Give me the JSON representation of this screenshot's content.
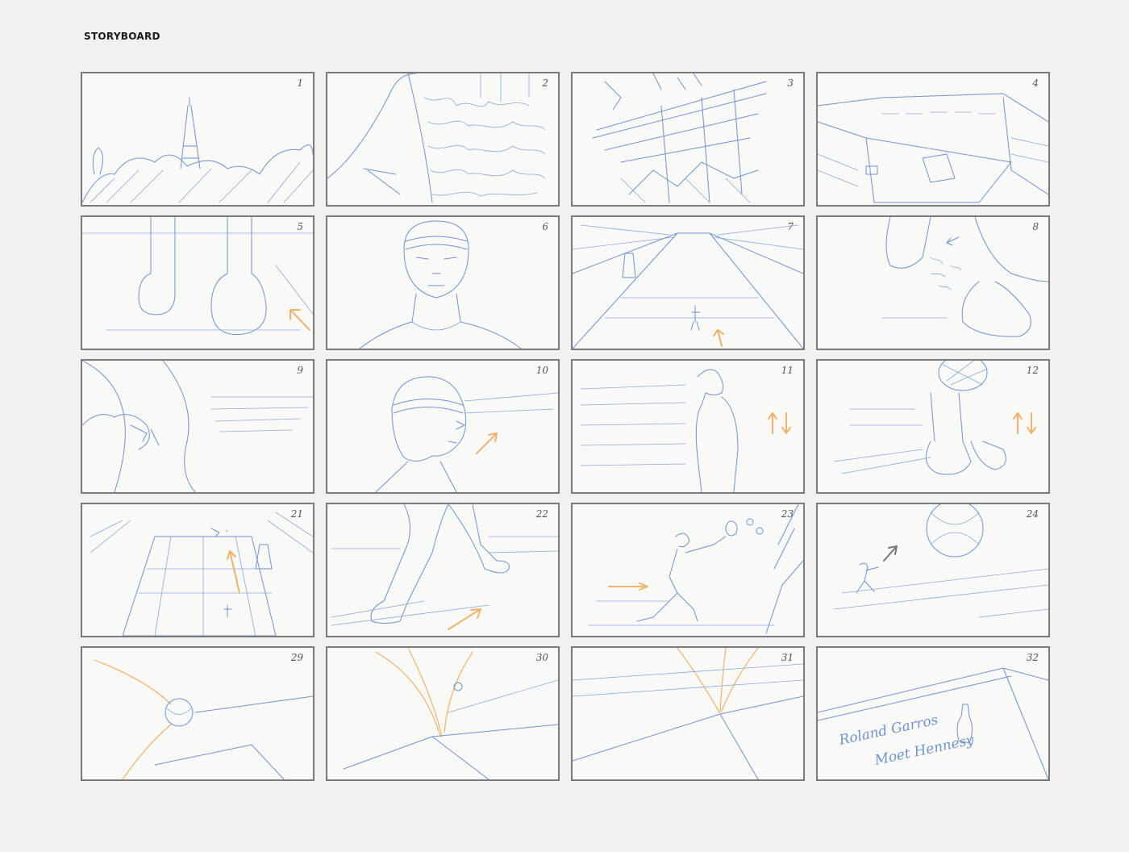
{
  "page": {
    "title": "STORYBOARD"
  },
  "panels": [
    {
      "number": "1",
      "icon": "paris-eiffel-tower-sketch"
    },
    {
      "number": "2",
      "icon": "stadium-crowd-sketch"
    },
    {
      "number": "3",
      "icon": "stadium-flags-sketch"
    },
    {
      "number": "4",
      "icon": "tennis-stadium-aerial-sketch"
    },
    {
      "number": "5",
      "icon": "player-feet-walking-sketch"
    },
    {
      "number": "6",
      "icon": "player-face-low-angle-sketch"
    },
    {
      "number": "7",
      "icon": "court-tunnel-sketch"
    },
    {
      "number": "8",
      "icon": "shoe-clay-dust-sketch"
    },
    {
      "number": "9",
      "icon": "hand-pocket-sketch"
    },
    {
      "number": "10",
      "icon": "player-profile-headband-sketch"
    },
    {
      "number": "11",
      "icon": "player-standing-profile-sketch"
    },
    {
      "number": "12",
      "icon": "racket-and-shoes-sketch"
    },
    {
      "number": "21",
      "icon": "court-rally-sketch"
    },
    {
      "number": "22",
      "icon": "player-legs-running-sketch"
    },
    {
      "number": "23",
      "icon": "player-forehand-sketch"
    },
    {
      "number": "24",
      "icon": "ball-closeup-player-sketch"
    },
    {
      "number": "29",
      "icon": "ball-trajectory-sketch"
    },
    {
      "number": "30",
      "icon": "ball-bounce-line-sketch"
    },
    {
      "number": "31",
      "icon": "ball-impact-sketch"
    },
    {
      "number": "32",
      "icon": "roland-garros-moet-hennessy-sketch",
      "lines": [
        "Roland Garros",
        "Moet Hennesy"
      ]
    }
  ]
}
